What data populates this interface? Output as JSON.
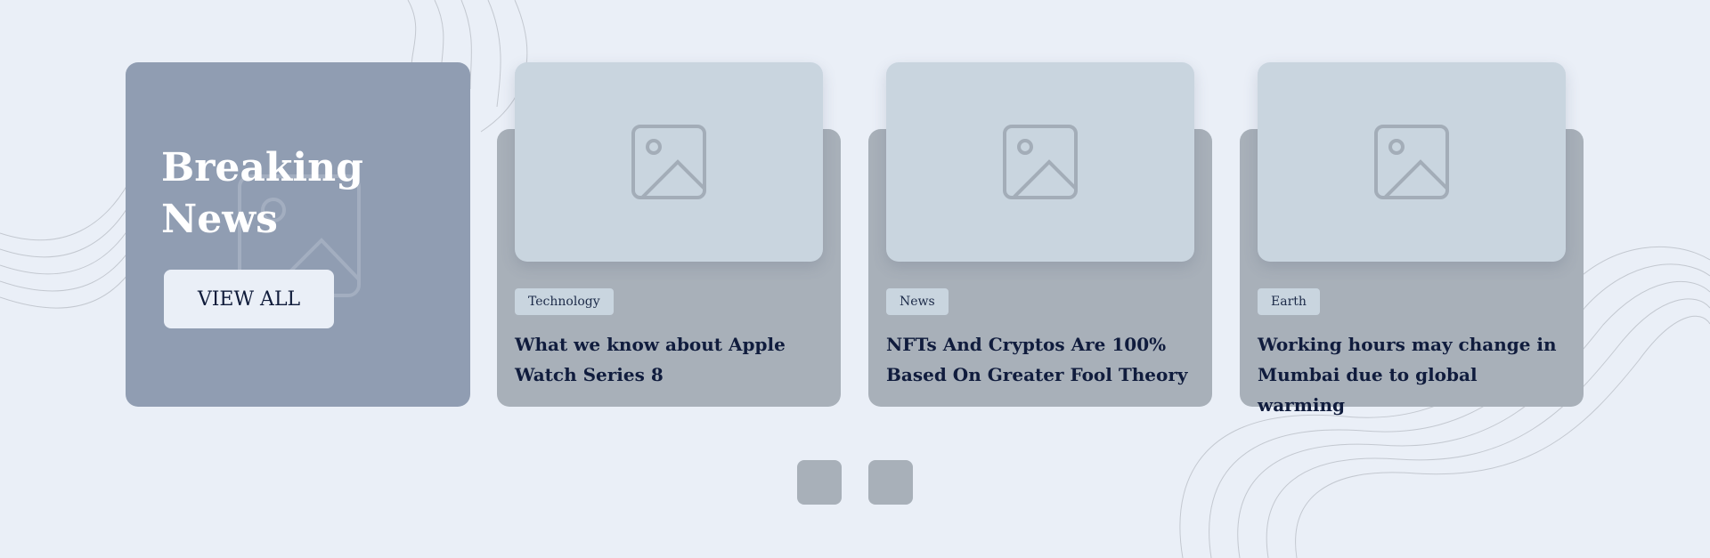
{
  "breaking": {
    "title": "Breaking News",
    "button_label": "VIEW ALL"
  },
  "cards": [
    {
      "tag": "Technology",
      "title": "What we know about Apple Watch Series 8"
    },
    {
      "tag": "News",
      "title": "NFTs And Cryptos Are 100% Based On Greater Fool Theory"
    },
    {
      "tag": "Earth",
      "title": "Working hours may change in Mumbai due to global warming"
    }
  ],
  "pagination": {
    "pages": 2
  },
  "colors": {
    "background": "#eaeff7",
    "feature": "#909db2",
    "card": "#a8b0b9",
    "thumb": "#c9d5df",
    "text_dark": "#101c3d"
  },
  "icons": [
    "image-placeholder-icon"
  ]
}
